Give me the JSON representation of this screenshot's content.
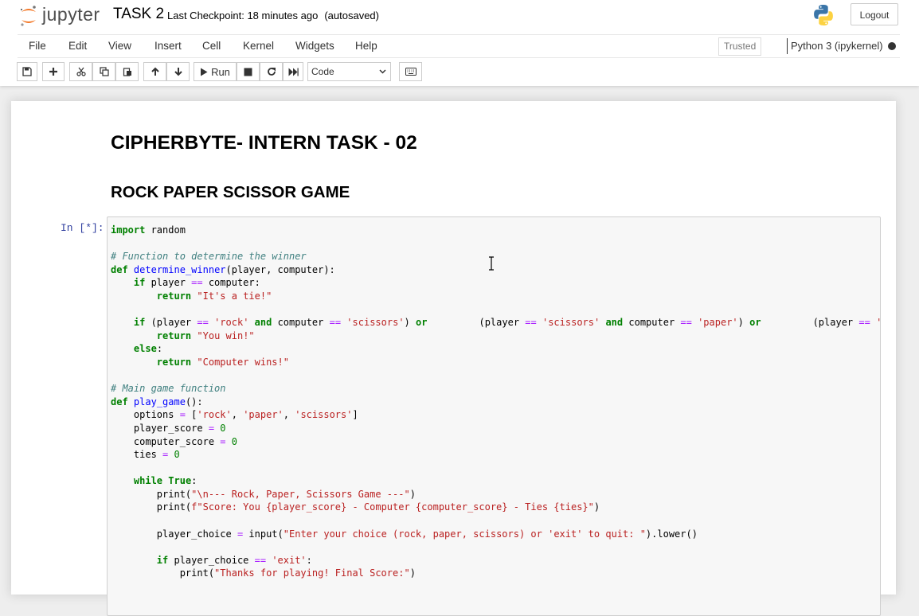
{
  "header": {
    "logo_text": "jupyter",
    "notebook_title": "TASK 2",
    "checkpoint": "Last Checkpoint: 18 minutes ago",
    "autosave": "(autosaved)",
    "logout_label": "Logout"
  },
  "menu": {
    "items": [
      "File",
      "Edit",
      "View",
      "Insert",
      "Cell",
      "Kernel",
      "Widgets",
      "Help"
    ],
    "trusted": "Trusted",
    "kernel": "Python 3 (ipykernel)"
  },
  "toolbar": {
    "run_label": "Run",
    "cell_type": "Code"
  },
  "notebook": {
    "heading1": "CIPHERBYTE- INTERN TASK - 02",
    "heading2": "ROCK PAPER SCISSOR GAME",
    "prompt": "In [*]:",
    "code_lines": [
      "import random",
      "",
      "# Function to determine the winner",
      "def determine_winner(player, computer):",
      "    if player == computer:",
      "        return \"It's a tie!\"",
      "",
      "    if (player == 'rock' and computer == 'scissors') or         (player == 'scissors' and computer == 'paper') or         (player == 'paper' and computer == 'rock'):",
      "        return \"You win!\"",
      "    else:",
      "        return \"Computer wins!\"",
      "",
      "# Main game function",
      "def play_game():",
      "    options = ['rock', 'paper', 'scissors']",
      "    player_score = 0",
      "    computer_score = 0",
      "    ties = 0",
      "",
      "    while True:",
      "        print(\"\\n--- Rock, Paper, Scissors Game ---\")",
      "        print(f\"Score: You {player_score} - Computer {computer_score} - Ties {ties}\")",
      "",
      "        player_choice = input(\"Enter your choice (rock, paper, scissors) or 'exit' to quit: \").lower()",
      "",
      "        if player_choice == 'exit':",
      "            print(\"Thanks for playing! Final Score:\")"
    ]
  }
}
